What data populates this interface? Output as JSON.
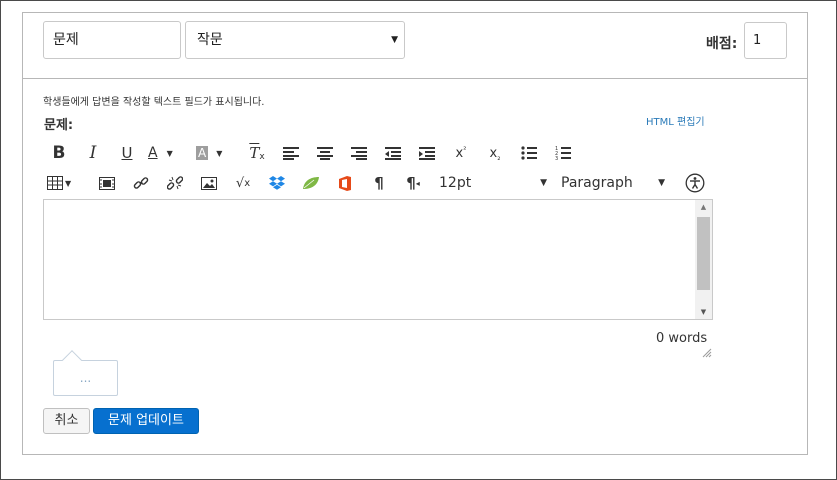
{
  "header": {
    "title_value": "문제",
    "type_value": "작문",
    "points_label": "배점:",
    "points_value": "1"
  },
  "editor": {
    "helper_text": "학생들에게 답변을 작성할 텍스트 필드가 표시됩니다.",
    "question_label": "문제:",
    "html_edit_label": "HTML 편집기",
    "font_size_value": "12pt",
    "block_format_value": "Paragraph",
    "content": "",
    "word_count": "0 words"
  },
  "toolbar": {
    "row1": [
      "bold-icon",
      "italic-icon",
      "underline-icon",
      "text-color-icon",
      "background-color-icon",
      "clear-format-icon",
      "align-left-icon",
      "align-center-icon",
      "align-right-icon",
      "outdent-icon",
      "indent-icon",
      "superscript-icon",
      "subscript-icon",
      "bullet-list-icon",
      "numbered-list-icon"
    ],
    "row2": [
      "table-icon",
      "media-icon",
      "link-icon",
      "unlink-icon",
      "image-icon",
      "equation-icon",
      "dropbox-icon",
      "leaf-icon",
      "office-icon",
      "ltr-icon",
      "rtl-icon",
      "accessibility-icon"
    ]
  },
  "bubble": {
    "label": "..."
  },
  "actions": {
    "cancel_label": "취소",
    "update_label": "문제 업데이트"
  },
  "colors": {
    "primary_button": "#0770cf",
    "link": "#2a7ab8",
    "dropbox": "#1f87e5",
    "leaf": "#7fb845",
    "office": "#e64a19"
  }
}
